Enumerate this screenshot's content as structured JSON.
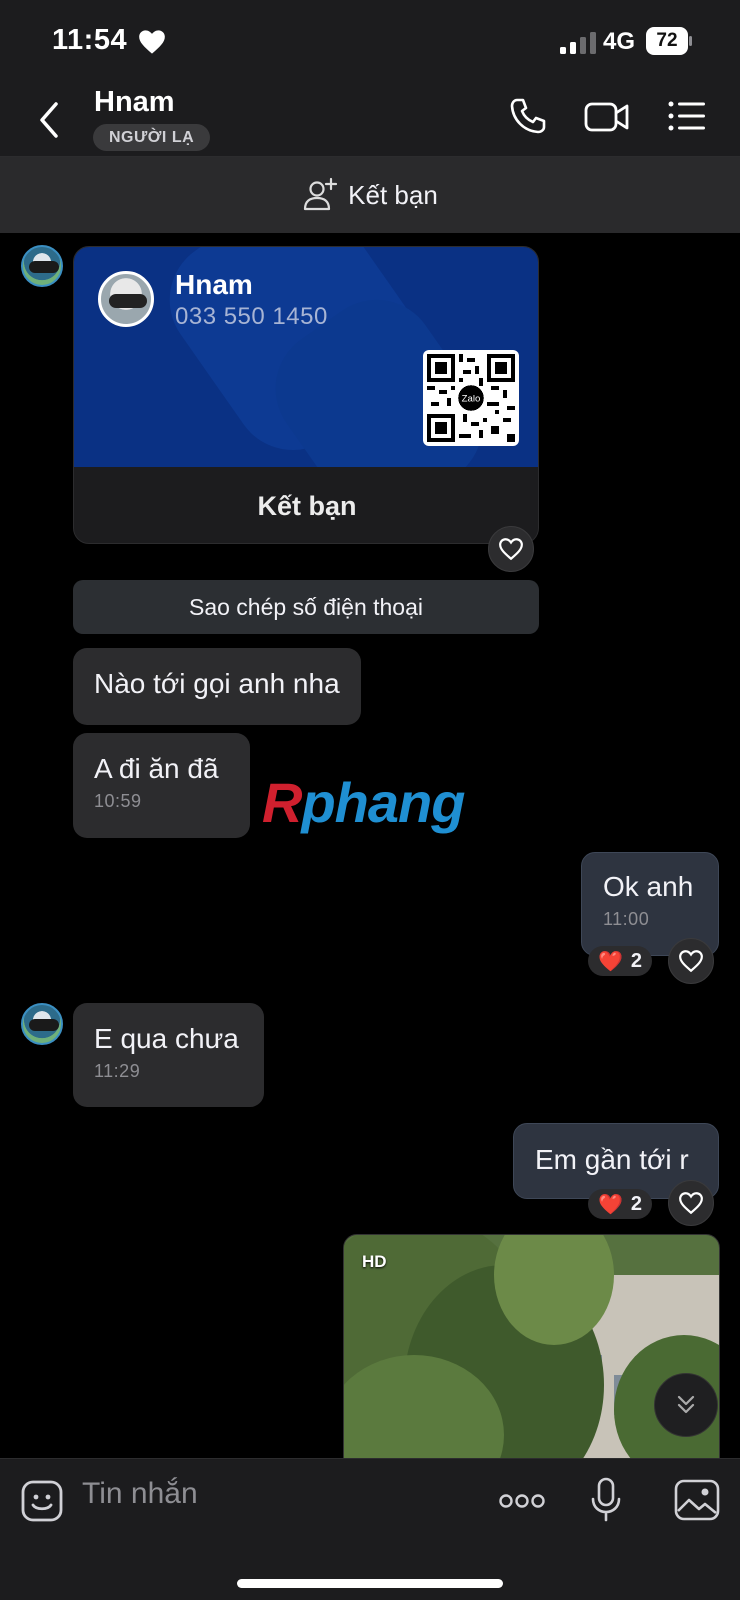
{
  "status_bar": {
    "time": "11:54",
    "network": "4G",
    "battery": "72"
  },
  "header": {
    "contact_name": "Hnam",
    "badge": "NGƯỜI LẠ"
  },
  "add_friend_banner": {
    "label": "Kết bạn"
  },
  "contact_card": {
    "name": "Hnam",
    "phone": "033 550 1450",
    "qr_logo": "Zalo",
    "button_label": "Kết bạn",
    "bg_color": "#0a3184"
  },
  "copy_phone_button": "Sao chép số điện thoại",
  "messages": [
    {
      "from": "other",
      "text": "Nào tới gọi anh nha"
    },
    {
      "from": "other",
      "text": "A đi ăn đã",
      "time": "10:59"
    },
    {
      "from": "me",
      "text": "Ok anh",
      "time": "11:00",
      "reaction": {
        "emoji": "❤️",
        "count": "2"
      }
    },
    {
      "from": "other",
      "text": "E qua chưa",
      "time": "11:29"
    },
    {
      "from": "me",
      "text": "Em gần tới r",
      "reaction": {
        "emoji": "❤️",
        "count": "2"
      }
    }
  ],
  "photo": {
    "badge": "HD"
  },
  "watermark": {
    "part1": "R",
    "part2": "phang"
  },
  "input_bar": {
    "placeholder": "Tin nhắn"
  },
  "icons": [
    "heart-icon",
    "signal-icon",
    "battery-icon",
    "back-chevron-icon",
    "phone-icon",
    "video-camera-icon",
    "list-menu-icon",
    "add-friend-icon",
    "like-heart-icon",
    "scroll-down-icon",
    "emoji-sticker-icon",
    "more-dots-icon",
    "microphone-icon",
    "image-gallery-icon"
  ]
}
